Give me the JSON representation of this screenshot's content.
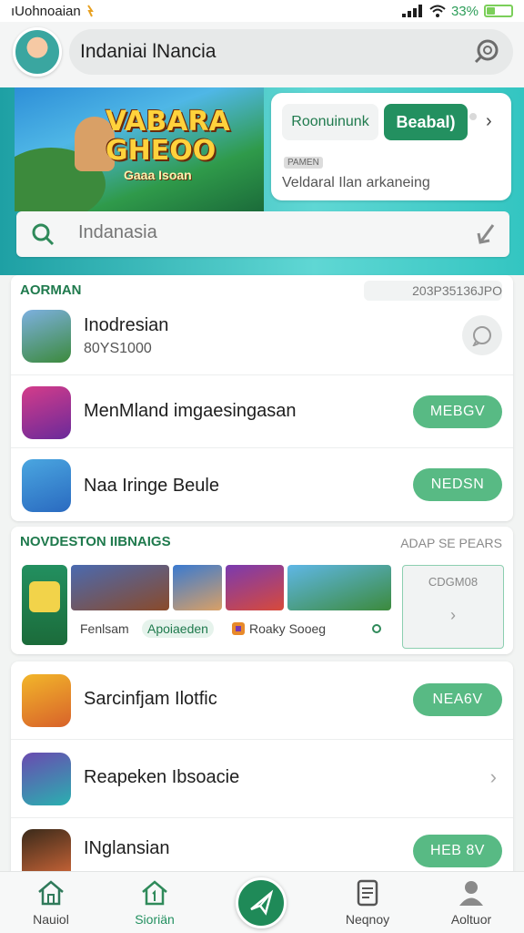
{
  "status_bar": {
    "carrier": "ıUohnoaian",
    "battery": "33%",
    "battery_level": 0.33
  },
  "header": {
    "search_text": "Indaniai lNancia"
  },
  "hero": {
    "title_line1": "VABARA",
    "title_line2": "GHEOO",
    "subtitle": "Gaaa Isoan",
    "promo": {
      "tab_label": "Roonuinunk",
      "button_label": "Beabal)",
      "tag": "PAMEN",
      "description": "Veldaral Ilan arkaneing"
    }
  },
  "search": {
    "placeholder": "Indanasia"
  },
  "section1": {
    "title": "AORMAN",
    "code": "203P35136JPO",
    "apps": [
      {
        "name": "Inodresian",
        "sub": "80YS1000",
        "action": ""
      },
      {
        "name": "MenMland imgaesingasan",
        "sub": "",
        "action": "MEBGV"
      },
      {
        "name": "Naa Iringe Beule",
        "sub": "",
        "action": "NEDSN"
      }
    ]
  },
  "section2": {
    "title": "NOVDESTON IIBNAIGS",
    "link": "ADAP SE PEARS",
    "thumb_labels": [
      "Fenlsam",
      "Apoiaeden",
      "Roaky Sooeg"
    ],
    "more_code": "CDGM08",
    "more_arrow": "›"
  },
  "section3": {
    "apps": [
      {
        "name": "Sarcinfjam Ilotfic",
        "action": "NEA6V"
      },
      {
        "name": "Reapeken Ibsoacie",
        "action": ""
      },
      {
        "name": "INglansian",
        "action": "HEB 8V"
      }
    ]
  },
  "nav": {
    "items": [
      {
        "label": "Nauiol"
      },
      {
        "label": "Sioriän"
      },
      {
        "label": "Neqnoy"
      },
      {
        "label": "Aoltuor"
      }
    ]
  },
  "colors": {
    "accent": "#239060",
    "pill": "#58ba84",
    "hero_bg": "#33c5c1"
  }
}
